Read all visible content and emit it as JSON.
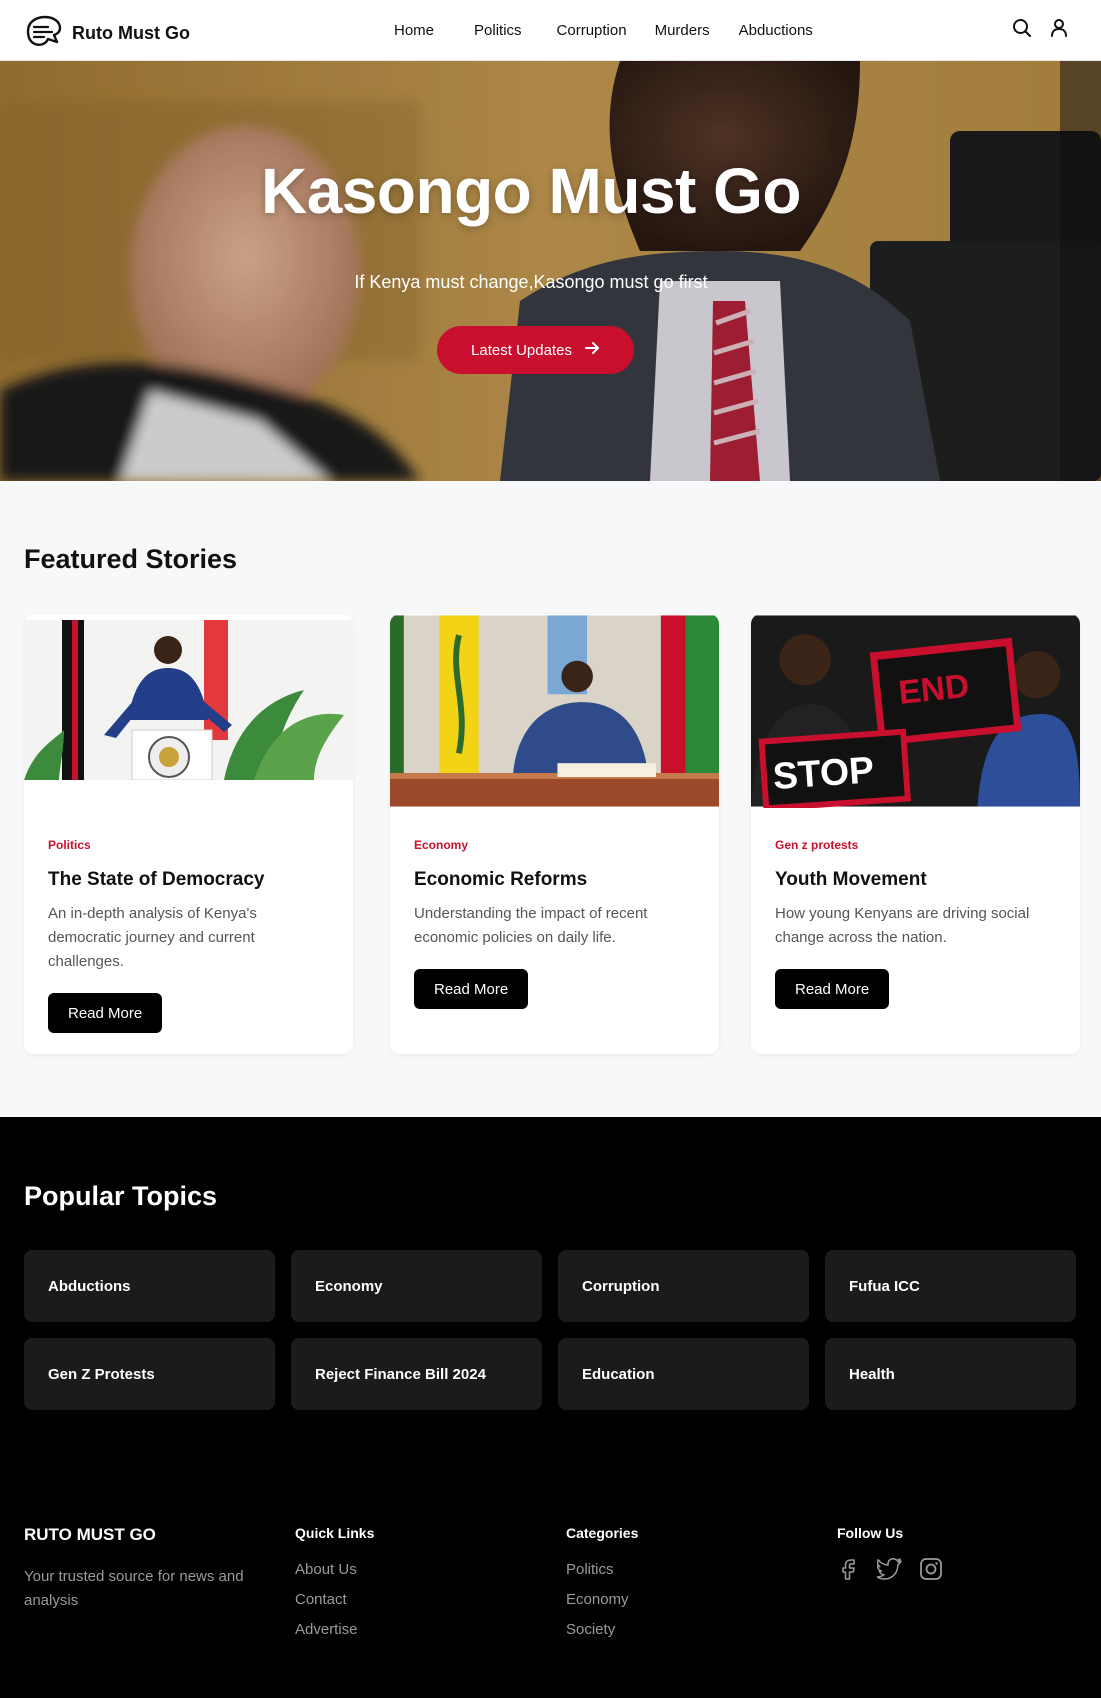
{
  "header": {
    "brand": "Ruto Must Go",
    "nav": [
      "Home",
      "Politics",
      "Corruption",
      "Murders",
      "Abductions"
    ],
    "icons": [
      "search-icon",
      "user-icon"
    ]
  },
  "hero": {
    "title": "Kasongo Must Go",
    "subtitle": "If Kenya must change,Kasongo must go first",
    "cta": "Latest Updates"
  },
  "featured": {
    "title": "Featured Stories",
    "cards": [
      {
        "category": "Politics",
        "title": "The State of Democracy",
        "description": "An in-depth analysis of Kenya's democratic journey and current challenges.",
        "button": "Read More"
      },
      {
        "category": "Economy",
        "title": "Economic Reforms",
        "description": "Understanding the impact of recent economic policies on daily life.",
        "button": "Read More"
      },
      {
        "category": "Gen z protests",
        "title": "Youth Movement",
        "description": "How young Kenyans are driving social change across the nation.",
        "button": "Read More"
      }
    ]
  },
  "topics": {
    "title": "Popular Topics",
    "items": [
      "Abductions",
      "Economy",
      "Corruption",
      "Fufua ICC",
      "Gen Z Protests",
      "Reject Finance Bill 2024",
      "Education",
      "Health"
    ]
  },
  "footer": {
    "brand": "RUTO MUST GO",
    "tagline": "Your trusted source for news and analysis",
    "quick_links": {
      "heading": "Quick Links",
      "links": [
        "About Us",
        "Contact",
        "Advertise"
      ]
    },
    "categories": {
      "heading": "Categories",
      "links": [
        "Politics",
        "Economy",
        "Society"
      ]
    },
    "follow": {
      "heading": "Follow Us",
      "icons": [
        "facebook-icon",
        "twitter-icon",
        "instagram-icon"
      ]
    }
  },
  "colors": {
    "accent": "#c8102e",
    "dark": "#000000",
    "tile": "#1b1b1b",
    "muted": "#9a9a9a"
  }
}
